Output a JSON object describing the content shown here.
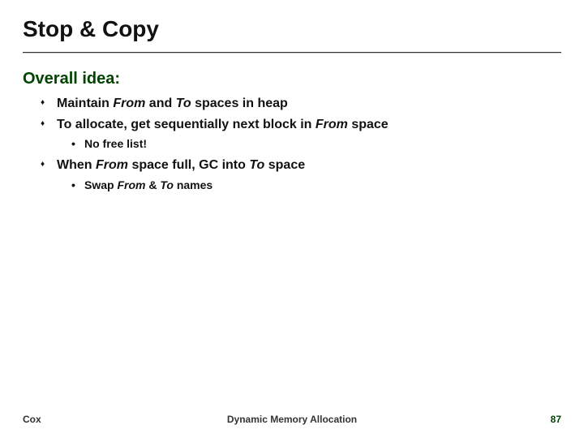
{
  "title": "Stop & Copy",
  "subhead": "Overall idea:",
  "bullet1": {
    "pre": "Maintain ",
    "em1": "From",
    "mid": " and ",
    "em2": "To",
    "post": " spaces in heap"
  },
  "bullet2": {
    "pre": "To allocate, get sequentially next block in ",
    "em": "From",
    "post": " space"
  },
  "bullet2_sub1": "No free list!",
  "bullet3": {
    "pre": "When ",
    "em1": "From",
    "mid": " space full, GC into ",
    "em2": "To",
    "post": " space"
  },
  "bullet3_sub1": {
    "pre": "Swap ",
    "em1": "From",
    "mid": " & ",
    "em2": "To",
    "post": " names"
  },
  "footer": {
    "left": "Cox",
    "center": "Dynamic Memory Allocation",
    "right": "87"
  }
}
